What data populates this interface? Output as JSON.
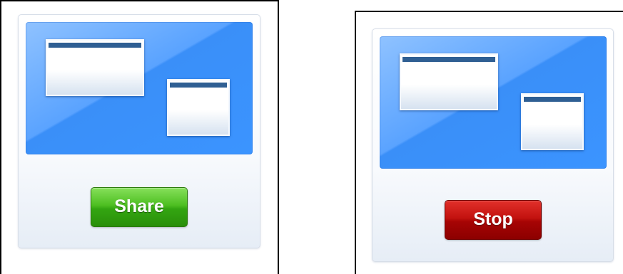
{
  "panels": {
    "share": {
      "button_label": "Share",
      "button_color": "#3fb018",
      "preview_color": "#3b94ff"
    },
    "stop": {
      "button_label": "Stop",
      "button_color": "#b00808",
      "preview_color": "#3b94ff"
    }
  },
  "icons": {
    "screen_preview": "screen-share-preview-icon",
    "window": "window-icon"
  }
}
